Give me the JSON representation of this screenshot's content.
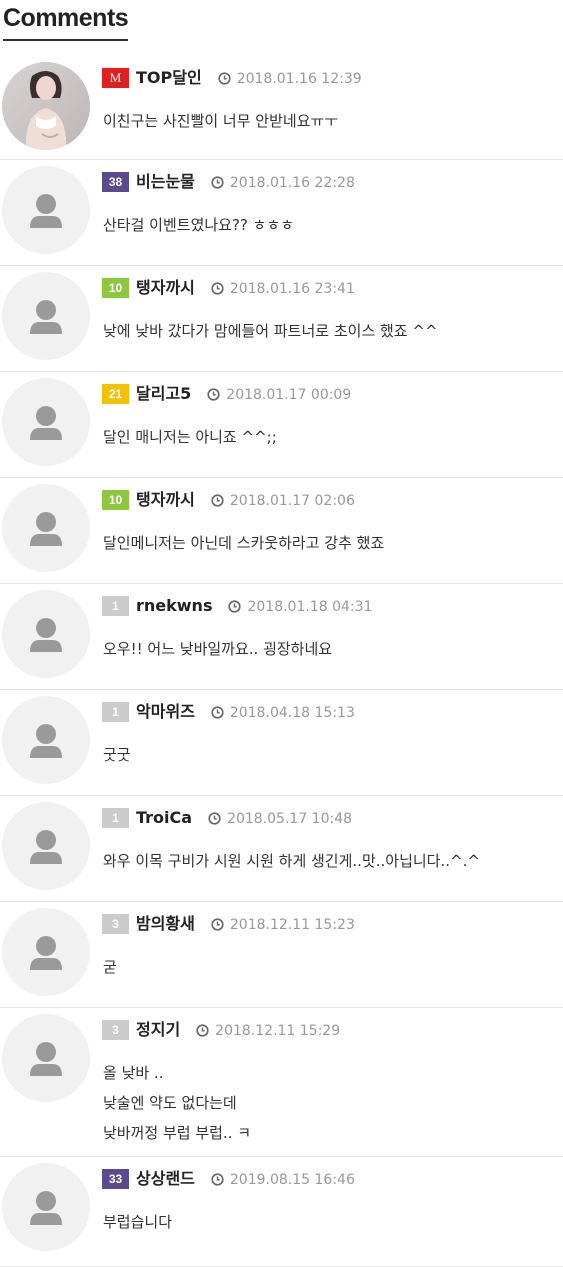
{
  "header": {
    "title": "Comments"
  },
  "colors": {
    "level_m": "#e02020",
    "level_purple": "#5b4a8e",
    "level_green": "#8dc63f",
    "level_yellow": "#f2c100",
    "level_gray": "#cccccc"
  },
  "comments": [
    {
      "level": "M",
      "level_color": "#e02020",
      "nick": "TOP달인",
      "time": "2018.01.16 12:39",
      "lines": [
        "이친구는 사진빨이 너무 안받네요ㅠㅜ"
      ],
      "avatar": "photo",
      "h": 104
    },
    {
      "level": "38",
      "level_color": "#5b4a8e",
      "nick": "비는눈물",
      "time": "2018.01.16 22:28",
      "lines": [
        "산타걸 이벤트였나요?? ㅎㅎㅎ"
      ],
      "avatar": "default",
      "h": 106
    },
    {
      "level": "10",
      "level_color": "#8dc63f",
      "nick": "탱자까시",
      "time": "2018.01.16 23:41",
      "lines": [
        "낮에 낮바 갔다가 맘에들어 파트너로 초이스 했죠 ^^"
      ],
      "avatar": "default",
      "h": 106
    },
    {
      "level": "21",
      "level_color": "#f2c100",
      "nick": "달리고5",
      "time": "2018.01.17 00:09",
      "lines": [
        "달인 매니저는 아니죠 ^^;;"
      ],
      "avatar": "default",
      "h": 106
    },
    {
      "level": "10",
      "level_color": "#8dc63f",
      "nick": "탱자까시",
      "time": "2018.01.17 02:06",
      "lines": [
        "달인메니저는 아닌데 스카웃하라고 강추 했죠"
      ],
      "avatar": "default",
      "h": 106
    },
    {
      "level": "1",
      "level_color": "#cccccc",
      "nick": "rnekwns",
      "time": "2018.01.18 04:31",
      "lines": [
        "오우!! 어느 낮바일까요.. 굉장하네요"
      ],
      "avatar": "default",
      "h": 106
    },
    {
      "level": "1",
      "level_color": "#cccccc",
      "nick": "악마위즈",
      "time": "2018.04.18 15:13",
      "lines": [
        "굿굿"
      ],
      "avatar": "default",
      "h": 106
    },
    {
      "level": "1",
      "level_color": "#cccccc",
      "nick": "TroiCa",
      "time": "2018.05.17 10:48",
      "lines": [
        "와우 이목 구비가 시원 시원 하게 생긴게..맛..아닙니다..^.^"
      ],
      "avatar": "default",
      "h": 106
    },
    {
      "level": "3",
      "level_color": "#cccccc",
      "nick": "밤의황새",
      "time": "2018.12.11 15:23",
      "lines": [
        "굳"
      ],
      "avatar": "default",
      "h": 106
    },
    {
      "level": "3",
      "level_color": "#cccccc",
      "nick": "정지기",
      "time": "2018.12.11 15:29",
      "lines": [
        "올 낮바 ..",
        "낮술엔 약도 없다는데",
        "낮바꺼정 부럽 부럽.. ㅋ"
      ],
      "avatar": "default",
      "h": 149
    },
    {
      "level": "33",
      "level_color": "#5b4a8e",
      "nick": "상상랜드",
      "time": "2019.08.15 16:46",
      "lines": [
        "부럽습니다"
      ],
      "avatar": "default",
      "h": 110
    }
  ]
}
